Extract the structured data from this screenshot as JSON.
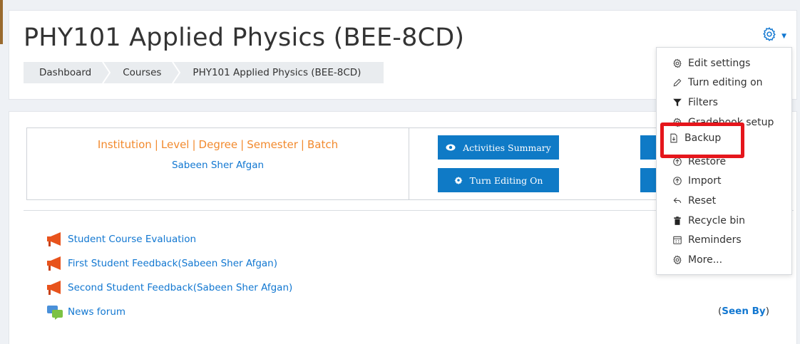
{
  "course": {
    "title": "PHY101 Applied Physics (BEE-8CD)"
  },
  "breadcrumb": [
    "Dashboard",
    "Courses",
    "PHY101 Applied Physics (BEE-8CD)"
  ],
  "info": {
    "meta": [
      "Institution",
      "Level",
      "Degree",
      "Semester",
      "Batch"
    ],
    "separator": "|",
    "teacher": "Sabeen Sher Afgan"
  },
  "buttons": {
    "activities_summary": "Activities Summary",
    "turn_editing_on": "Turn Editing On"
  },
  "activities": [
    {
      "label": "Student Course Evaluation",
      "icon": "megaphone-icon"
    },
    {
      "label": "First Student Feedback(Sabeen Sher Afgan)",
      "icon": "megaphone-icon"
    },
    {
      "label": "Second Student Feedback(Sabeen Sher Afgan)",
      "icon": "megaphone-icon"
    },
    {
      "label": "News forum",
      "icon": "forum-icon"
    }
  ],
  "seen_by": {
    "open": "(",
    "link": "Seen By",
    "close": ")"
  },
  "menu": {
    "items": [
      {
        "label": "Edit settings",
        "icon": "gear-icon"
      },
      {
        "label": "Turn editing on",
        "icon": "pencil-icon"
      },
      {
        "label": "Filters",
        "icon": "filter-icon"
      },
      {
        "label": "Gradebook setup",
        "icon": "gear-icon"
      },
      {
        "label": "Backup",
        "icon": "file-download-icon"
      },
      {
        "label": "Restore",
        "icon": "upload-icon"
      },
      {
        "label": "Import",
        "icon": "upload-icon"
      },
      {
        "label": "Reset",
        "icon": "reset-icon"
      },
      {
        "label": "Recycle bin",
        "icon": "trash-icon"
      },
      {
        "label": "Reminders",
        "icon": "calendar-icon"
      },
      {
        "label": "More...",
        "icon": "gear-icon"
      }
    ],
    "highlighted": "Backup"
  },
  "colors": {
    "accent": "#1177d1",
    "button": "#0f7ac6",
    "meta_orange": "#f28a2e",
    "highlight_red": "#e5161c"
  }
}
